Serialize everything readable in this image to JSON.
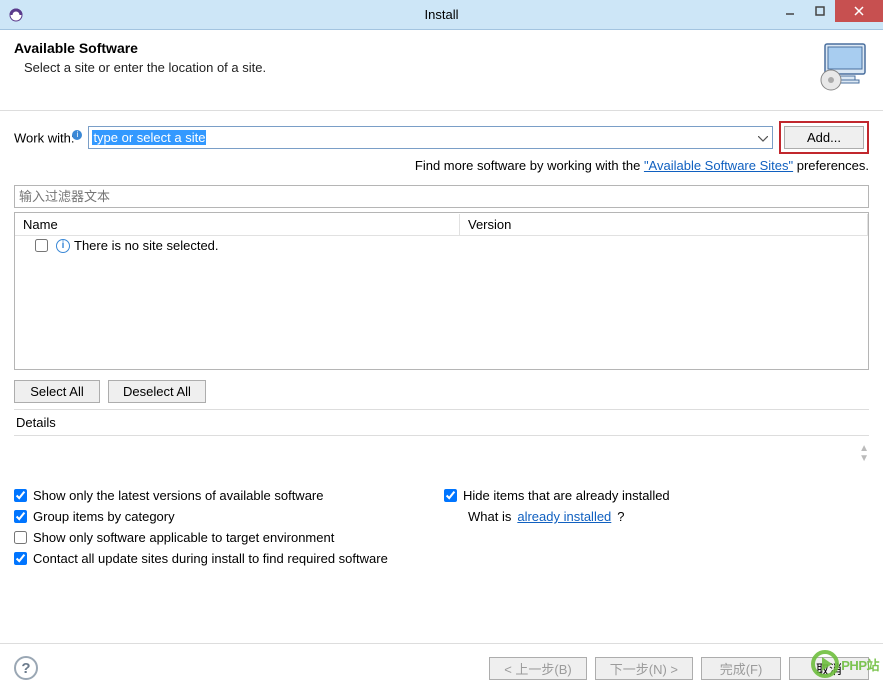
{
  "window": {
    "title": "Install"
  },
  "header": {
    "title": "Available Software",
    "subtitle": "Select a site or enter the location of a site."
  },
  "workwith": {
    "label": "Work with:",
    "placeholder": "type or select a site",
    "add_button": "Add..."
  },
  "findmore": {
    "prefix": "Find more software by working with the ",
    "link": "\"Available Software Sites\"",
    "suffix": " preferences."
  },
  "filter": {
    "placeholder": "输入过滤器文本"
  },
  "tree": {
    "columns": {
      "name": "Name",
      "version": "Version"
    },
    "empty_row": "There is no site selected."
  },
  "selectbtns": {
    "select_all": "Select All",
    "deselect_all": "Deselect All"
  },
  "details": {
    "label": "Details"
  },
  "options": {
    "show_latest": "Show only the latest versions of available software",
    "group_by_category": "Group items by category",
    "applicable_target": "Show only software applicable to target environment",
    "contact_all": "Contact all update sites during install to find required software",
    "hide_installed": "Hide items that are already installed",
    "what_is_prefix": "What is ",
    "what_is_link": "already installed",
    "what_is_suffix": "?",
    "checked": {
      "show_latest": true,
      "group_by_category": true,
      "applicable_target": false,
      "contact_all": true,
      "hide_installed": true
    }
  },
  "footer": {
    "back": "< 上一步(B)",
    "next": "下一步(N) >",
    "finish": "完成(F)",
    "cancel": "取消"
  },
  "watermark": "PHP站"
}
